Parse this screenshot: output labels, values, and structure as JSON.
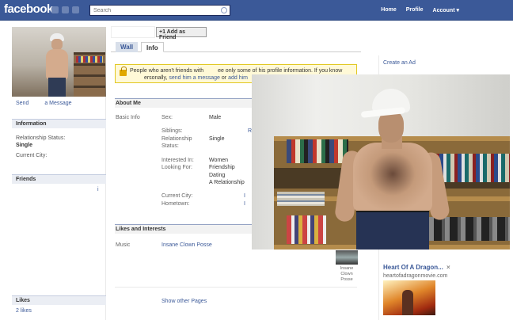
{
  "topbar": {
    "logo": "facebook",
    "search_placeholder": "Search",
    "nav": [
      "Home",
      "Profile",
      "Account ▾"
    ]
  },
  "profile_actions": {
    "add_friend": "+1 Add as Friend",
    "send": "Send",
    "message": "a Message"
  },
  "tabs": [
    "Wall",
    "Info"
  ],
  "notice": {
    "line1": "People who aren't friends with",
    "line1b": "ee only some of his profile information. If you know",
    "line2a": "ersonally,",
    "line2_link1": "send him a message",
    "line2_or": "or",
    "line2_link2": "add him"
  },
  "left_sections": {
    "information": "Information",
    "rel_status_label": "Relationship Status:",
    "rel_status_value": "Single",
    "current_city_label": "Current City:",
    "friends": "Friends",
    "friends_more": "i",
    "likes": "Likes",
    "likes_count": "2 likes"
  },
  "about_me": {
    "header": "About Me",
    "basic_info": "Basic Info",
    "sex_label": "Sex:",
    "sex_value": "Male",
    "siblings_label": "Siblings:",
    "siblings_value": "R",
    "relationship_label": "Relationship",
    "relationship_label2": "Status:",
    "relationship_value": "Single",
    "interested_label": "Interested In:",
    "interested_value": "Women",
    "looking_label": "Looking For:",
    "looking_values": [
      "Friendship",
      "Dating",
      "A Relationship"
    ],
    "current_city_label": "Current City:",
    "current_city_value": "I",
    "hometown_label": "Hometown:",
    "hometown_value": "I"
  },
  "likes_interests": {
    "header": "Likes and Interests",
    "music_label": "Music",
    "music_value": "Insane Clown Posse",
    "thumb_caption": "Insane Clown Posse",
    "show_other": "Show other Pages"
  },
  "right": {
    "create_ad": "Create an Ad",
    "ad_title": "Heart Of A Dragon...",
    "ad_close": "×",
    "ad_url": "heartofadragonmovie.com"
  }
}
